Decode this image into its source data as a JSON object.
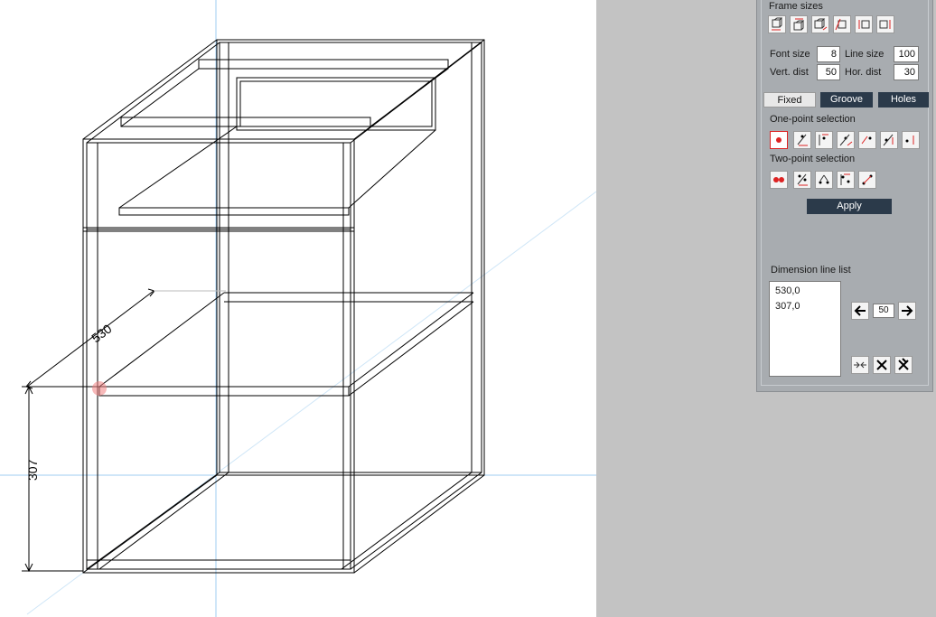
{
  "colors": {
    "viewport_bg": "#ffffff",
    "workspace_bg": "#c3c3c3",
    "panel_bg": "#a8acb0",
    "button_dark": "#2b3a4a",
    "accent_red": "#dd2222",
    "axis_blue": "#5fa8e0"
  },
  "viewport": {
    "dimension_depth": "530",
    "dimension_height": "307"
  },
  "panel": {
    "frame_sizes_title": "Frame sizes",
    "frame_size_icons": [
      "frame-size-width-icon",
      "frame-size-top-width-icon",
      "frame-size-depth-icon",
      "frame-size-diagonal-icon",
      "frame-size-height-icon",
      "frame-size-height-right-icon"
    ],
    "font_size_label": "Font size",
    "font_size_value": "8",
    "line_size_label": "Line size",
    "line_size_value": "100",
    "vert_dist_label": "Vert. dist",
    "vert_dist_value": "50",
    "hor_dist_label": "Hor. dist",
    "hor_dist_value": "30",
    "mode_buttons": [
      "Fixed",
      "Groove",
      "Holes"
    ],
    "one_point_title": "One-point selection",
    "one_point_icons": [
      "single-point-icon",
      "point-horizontal-icon",
      "point-vertical-icon",
      "point-depth-icon",
      "point-diagonal-icon",
      "point-height-icon",
      "point-offset-icon"
    ],
    "two_point_title": "Two-point selection",
    "two_point_icons": [
      "two-points-icon",
      "two-point-horizontal-icon",
      "two-point-diagonal-icon",
      "two-point-vertical-icon",
      "two-point-line-icon"
    ],
    "apply_label": "Apply",
    "dimension_list_title": "Dimension line list",
    "dimension_list": [
      "530,0",
      "307,0"
    ],
    "step_value": "50",
    "list_action_icons": [
      "arrow-left-icon",
      "arrow-right-icon",
      "merge-icon",
      "delete-icon",
      "delete-all-icon"
    ]
  }
}
